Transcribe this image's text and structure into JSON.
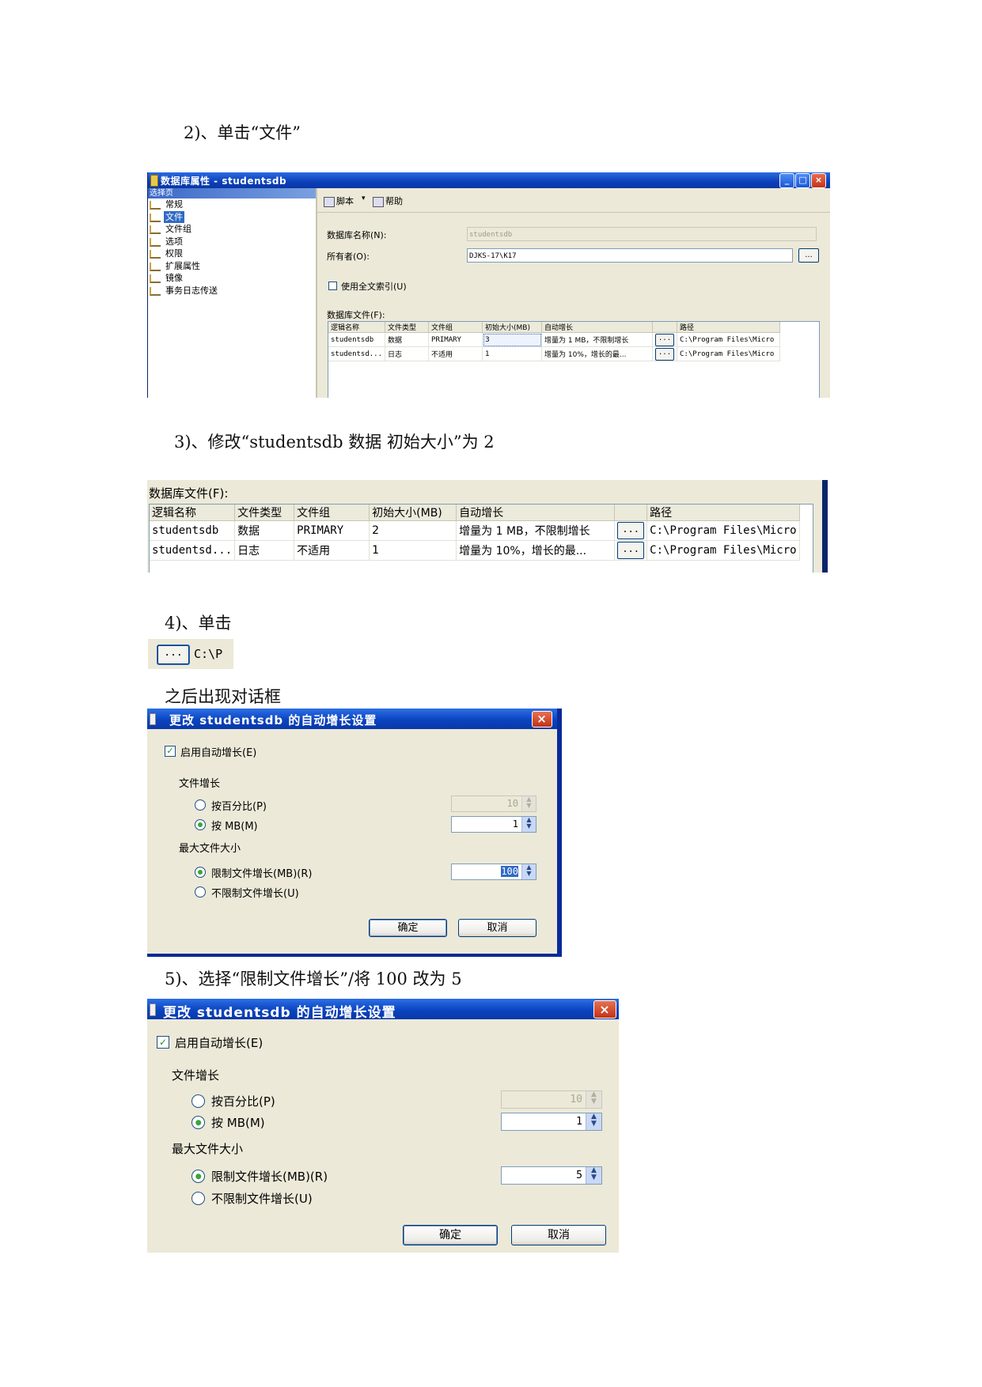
{
  "steps": {
    "s2": "2)、单击“文件”",
    "s3": "3)、修改“studentsdb  数据    初始大小”为 2",
    "s4": "4)、单击",
    "s4b": "之后出现对话框",
    "s5": "5)、选择“限制文件增长”/将 100 改为 5"
  },
  "props_window": {
    "title": "数据库属性 - studentsdb",
    "controls": {
      "minimize": "_",
      "maximize": "□",
      "close": "×"
    },
    "nav_header": "选择页",
    "nav_items": [
      "常规",
      "文件",
      "文件组",
      "选项",
      "权限",
      "扩展属性",
      "镜像",
      "事务日志传送"
    ],
    "selected_nav": "文件",
    "toolbar": {
      "script": "脚本",
      "dropdown_arrow": "▾",
      "help": "帮助"
    },
    "db_name_label": "数据库名称(N):",
    "db_name_value": "studentsdb",
    "owner_label": "所有者(O):",
    "owner_value": "DJKS-17\\K17",
    "owner_browse": "...",
    "fulltext_label": "使用全文索引(U)",
    "fulltext_checked": false,
    "files_label": "数据库文件(F):"
  },
  "file_grid": {
    "columns": [
      "逻辑名称",
      "文件类型",
      "文件组",
      "初始大小(MB)",
      "自动增长",
      "",
      "路径"
    ],
    "rows_before": [
      [
        "studentsdb",
        "数据",
        "PRIMARY",
        "3",
        "增量为 1 MB，不限制增长",
        "...",
        "C:\\Program Files\\Micro"
      ],
      [
        "studentsd...",
        "日志",
        "不适用",
        "1",
        "增量为 10%，增长的最...",
        "...",
        "C:\\Program Files\\Micro"
      ]
    ],
    "rows_after": [
      [
        "studentsdb",
        "数据",
        "PRIMARY",
        "2",
        "增量为 1 MB，不限制增长",
        "...",
        "C:\\Program Files\\Micro"
      ],
      [
        "studentsd...",
        "日志",
        "不适用",
        "1",
        "增量为 10%，增长的最...",
        "...",
        "C:\\Program Files\\Micro"
      ]
    ]
  },
  "crop": {
    "button": "...",
    "path": "C:\\P"
  },
  "autogrow_dialog": {
    "title": "更改 studentsdb 的自动增长设置",
    "close": "×",
    "enable_label": "启用自动增长(E)",
    "enable_checked": true,
    "file_growth_label": "文件增长",
    "by_percent_label": "按百分比(P)",
    "percent_value": "10",
    "by_mb_label": "按 MB(M)",
    "mb_value": "1",
    "max_size_label": "最大文件大小",
    "limit_label": "限制文件增长(MB)(R)",
    "unlimited_label": "不限制文件增长(U)",
    "ok": "确定",
    "cancel": "取消",
    "before": {
      "growth_mode": "mb",
      "limit_mode": "limited",
      "limit_value": "100",
      "limit_selected": true
    },
    "after": {
      "growth_mode": "mb",
      "limit_mode": "limited",
      "limit_value": "5",
      "limit_selected": false
    }
  }
}
